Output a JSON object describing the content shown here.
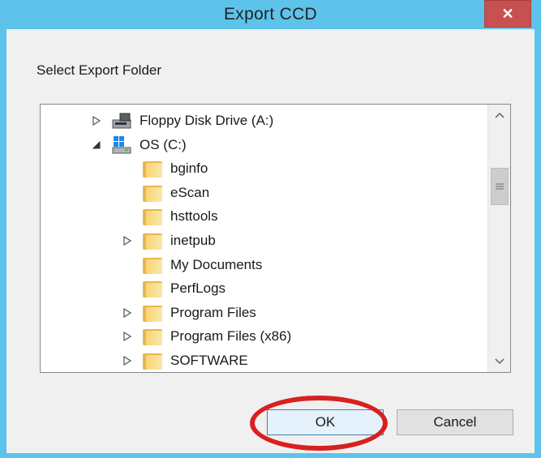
{
  "window": {
    "title": "Export CCD",
    "close_glyph": "✕"
  },
  "dialog": {
    "prompt": "Select Export Folder"
  },
  "tree": {
    "items": [
      {
        "label": "Floppy Disk Drive (A:)",
        "expander": "collapsed",
        "icon": "floppy-drive-icon",
        "indent": 0
      },
      {
        "label": "OS (C:)",
        "expander": "expanded",
        "icon": "hard-drive-icon",
        "indent": 0
      },
      {
        "label": "bginfo",
        "expander": "none",
        "icon": "folder-icon",
        "indent": 1
      },
      {
        "label": "eScan",
        "expander": "none",
        "icon": "folder-icon",
        "indent": 1
      },
      {
        "label": "hsttools",
        "expander": "none",
        "icon": "folder-icon",
        "indent": 1
      },
      {
        "label": "inetpub",
        "expander": "collapsed",
        "icon": "folder-icon",
        "indent": 1
      },
      {
        "label": "My Documents",
        "expander": "none",
        "icon": "folder-icon",
        "indent": 1
      },
      {
        "label": "PerfLogs",
        "expander": "none",
        "icon": "folder-icon",
        "indent": 1
      },
      {
        "label": "Program Files",
        "expander": "collapsed",
        "icon": "folder-icon",
        "indent": 1
      },
      {
        "label": "Program Files (x86)",
        "expander": "collapsed",
        "icon": "folder-icon",
        "indent": 1
      },
      {
        "label": "SOFTWARE",
        "expander": "collapsed",
        "icon": "folder-icon",
        "indent": 1
      }
    ]
  },
  "buttons": {
    "ok": "OK",
    "cancel": "Cancel"
  },
  "colors": {
    "titlebar": "#5ec3ea",
    "close": "#c75050",
    "annotation": "#d82020"
  }
}
